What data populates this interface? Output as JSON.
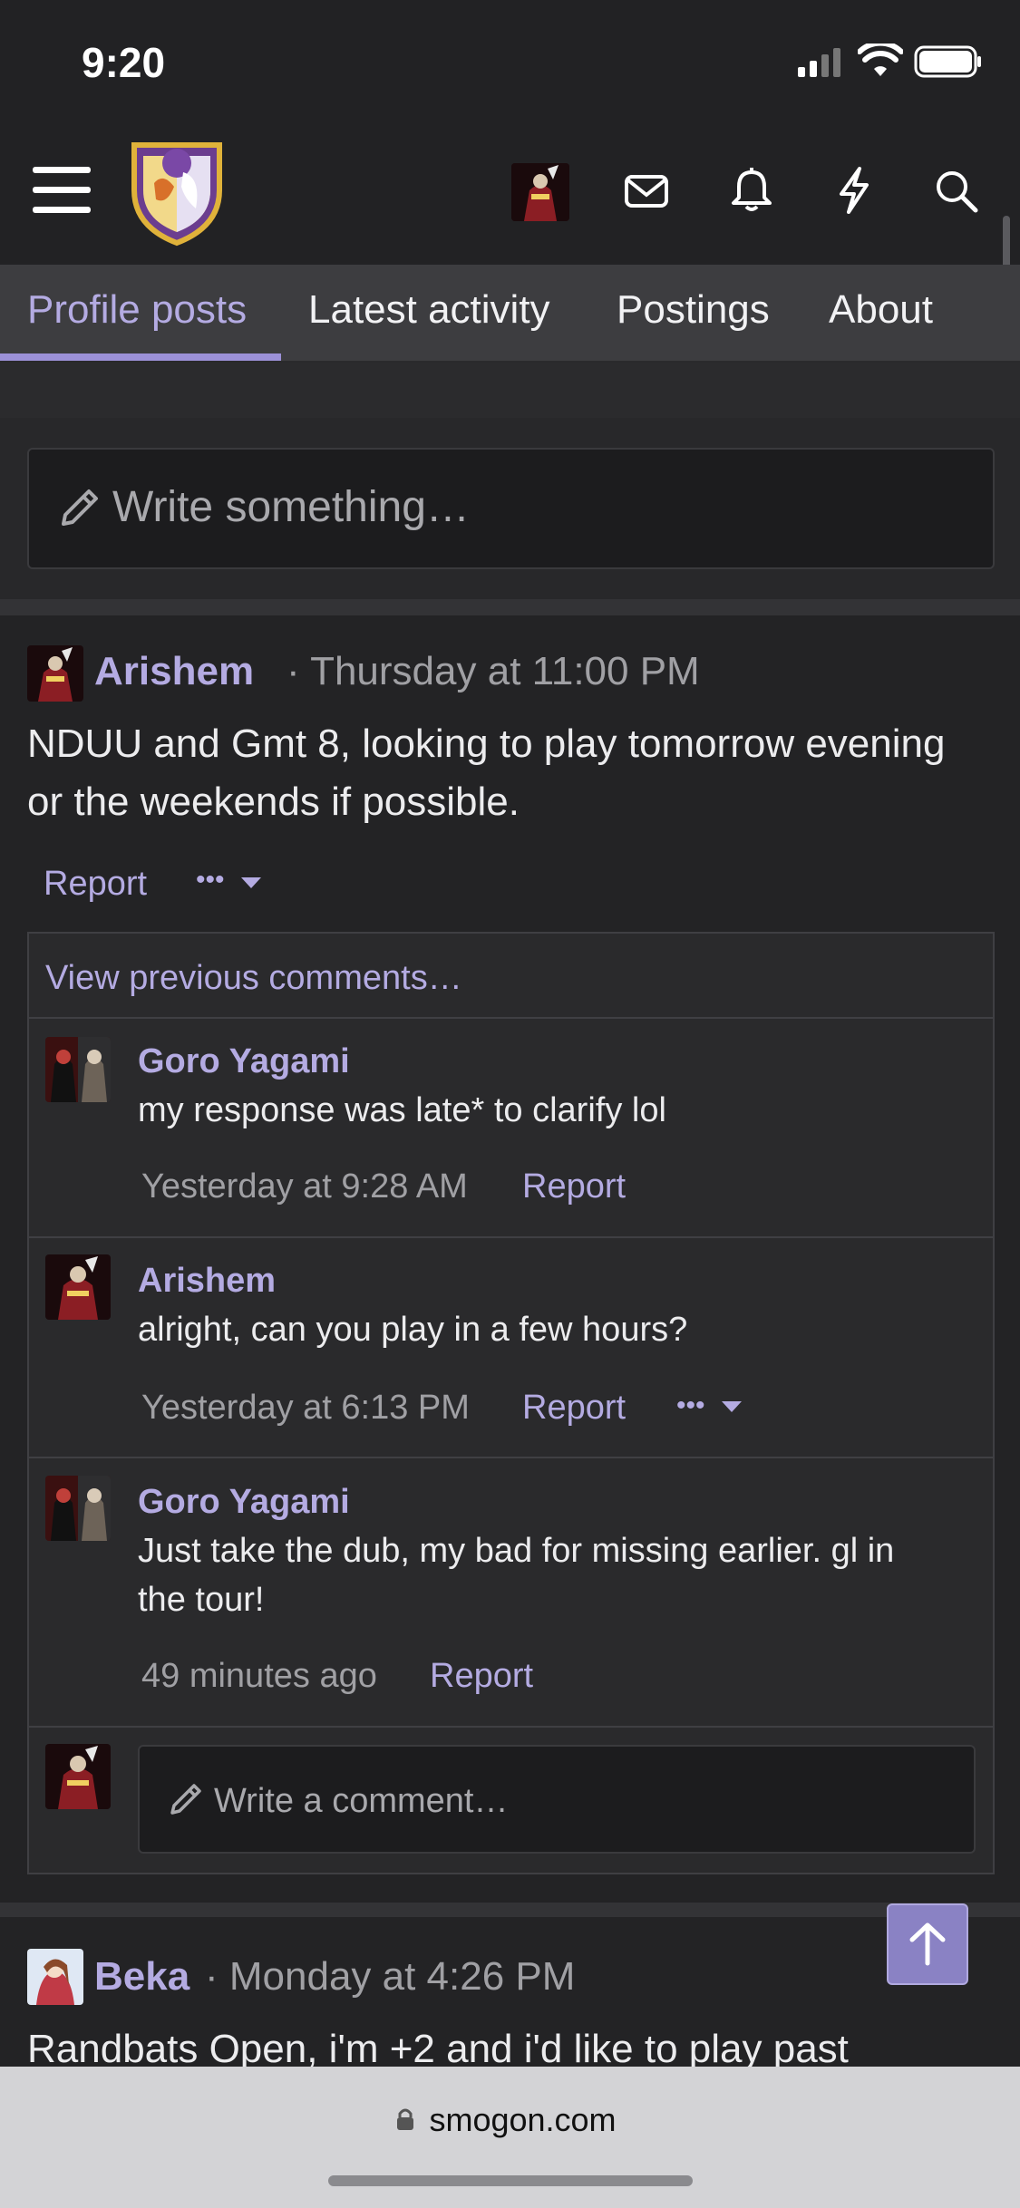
{
  "status_bar": {
    "time": "9:20"
  },
  "tabs": [
    {
      "label": "Profile posts",
      "active": true
    },
    {
      "label": "Latest activity",
      "active": false
    },
    {
      "label": "Postings",
      "active": false
    },
    {
      "label": "About",
      "active": false
    }
  ],
  "composer": {
    "placeholder": "Write something…"
  },
  "post1": {
    "author": "Arishem",
    "time": "· Thursday at 11:00 PM",
    "text_line1": "NDUU and Gmt 8, looking to play tomorrow evening",
    "text_line2": "or the weekends if possible.",
    "report": "Report",
    "more": "•••"
  },
  "comments": {
    "view_previous": "View previous comments…",
    "items": [
      {
        "author": "Goro Yagami",
        "text": "my response was late* to clarify lol",
        "time": "Yesterday at 9:28 AM",
        "report": "Report"
      },
      {
        "author": "Arishem",
        "text": "alright, can you play in a few hours?",
        "time": "Yesterday at 6:13 PM",
        "report": "Report",
        "more": "•••"
      },
      {
        "author": "Goro Yagami",
        "text_line1": "Just take the dub, my bad for missing earlier. gl in",
        "text_line2": "the tour!",
        "time": "49 minutes ago",
        "report": "Report"
      }
    ],
    "write_placeholder": "Write a comment…"
  },
  "post2": {
    "author": "Beka",
    "time": "· Monday at 4:26 PM",
    "text_partial": "Randbats Open, i'm +2 and i'd like to play past"
  },
  "url_bar": {
    "domain": "smogon.com"
  },
  "colors": {
    "accent": "#b4abe2",
    "background": "#222224",
    "tab_bar": "#3d3d40"
  }
}
